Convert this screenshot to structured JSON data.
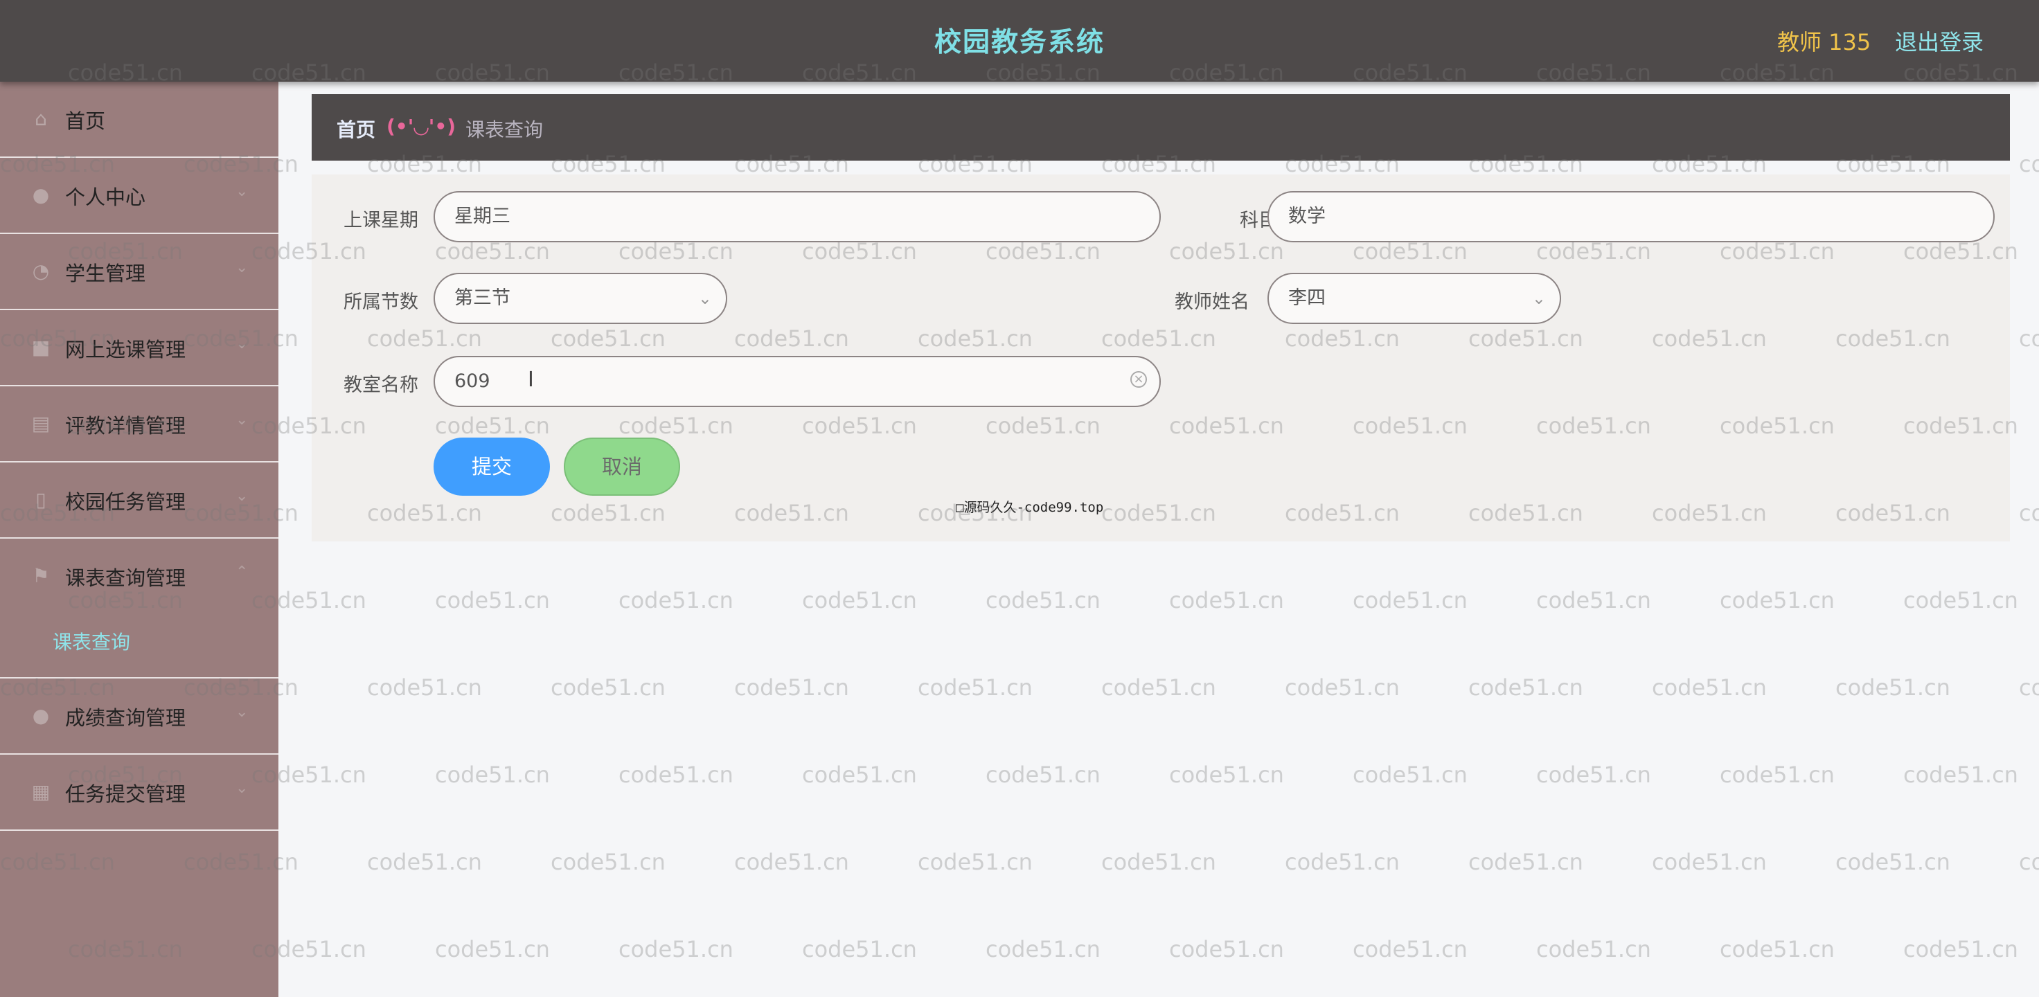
{
  "header": {
    "title": "校园教务系统",
    "user": "教师 135",
    "logout": "退出登录"
  },
  "sidebar": {
    "items": [
      {
        "label": "首页",
        "icon": "home-icon",
        "has_children": false
      },
      {
        "label": "个人中心",
        "icon": "user-icon",
        "has_children": true
      },
      {
        "label": "学生管理",
        "icon": "clock-icon",
        "has_children": true
      },
      {
        "label": "网上选课管理",
        "icon": "video-icon",
        "has_children": true
      },
      {
        "label": "评教详情管理",
        "icon": "clipboard-icon",
        "has_children": true
      },
      {
        "label": "校园任务管理",
        "icon": "document-icon",
        "has_children": true
      },
      {
        "label": "课表查询管理",
        "icon": "flag-icon",
        "has_children": true
      },
      {
        "label": "成绩查询管理",
        "icon": "user-icon",
        "has_children": true
      },
      {
        "label": "任务提交管理",
        "icon": "grid-icon",
        "has_children": true
      }
    ],
    "active_sub": "课表查询"
  },
  "breadcrumb": {
    "home": "首页",
    "separator": "(•'◡'•)",
    "current": "课表查询"
  },
  "form": {
    "weekday_label": "上课星期",
    "weekday_value": "星期三",
    "subject_label": "科目",
    "subject_value": "数学",
    "period_label": "所属节数",
    "period_value": "第三节",
    "teacher_label": "教师姓名",
    "teacher_value": "李四",
    "room_label": "教室名称",
    "room_value": "609",
    "submit": "提交",
    "cancel": "取消"
  },
  "source_note": "□源码久久-code99.top",
  "watermark": "code51.cn",
  "colors": {
    "header_bg": "#4e4a4a",
    "title": "#7fe0e6",
    "user": "#f0c34a",
    "sidebar_bg": "#9a7d7d",
    "submit": "#409efe",
    "cancel": "#8fd98c"
  }
}
